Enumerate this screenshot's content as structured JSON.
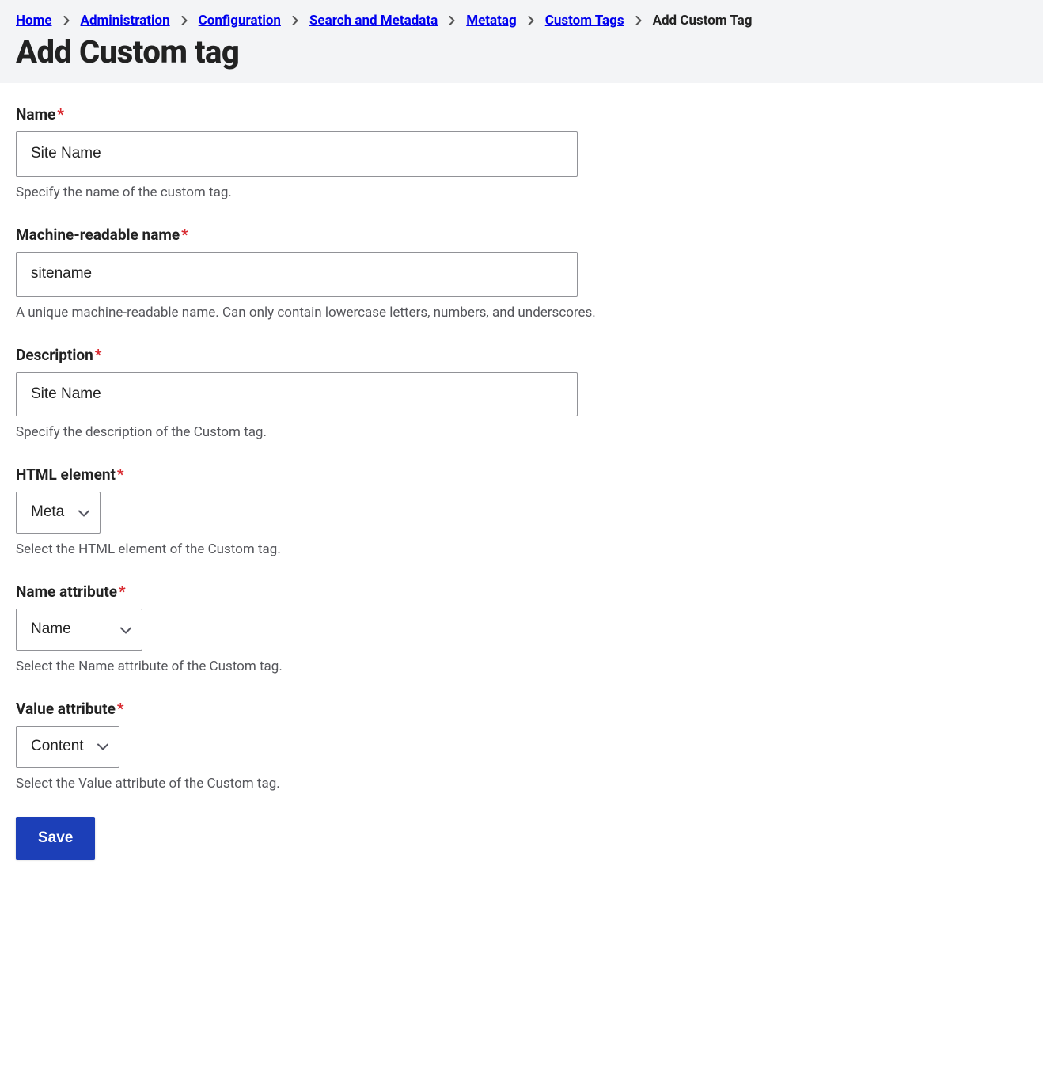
{
  "breadcrumbs": [
    {
      "label": "Home"
    },
    {
      "label": "Administration"
    },
    {
      "label": "Configuration"
    },
    {
      "label": "Search and Metadata"
    },
    {
      "label": "Metatag"
    },
    {
      "label": "Custom Tags"
    },
    {
      "label": "Add Custom Tag"
    }
  ],
  "page_title": "Add Custom tag",
  "form": {
    "name": {
      "label": "Name",
      "value": "Site Name",
      "description": "Specify the name of the custom tag."
    },
    "machine_name": {
      "label": "Machine-readable name",
      "value": "sitename",
      "description": "A unique machine-readable name. Can only contain lowercase letters, numbers, and underscores."
    },
    "description_field": {
      "label": "Description",
      "value": "Site Name",
      "description": "Specify the description of the Custom tag."
    },
    "html_element": {
      "label": "HTML element",
      "value": "Meta",
      "description": "Select the HTML element of the Custom tag."
    },
    "name_attribute": {
      "label": "Name attribute",
      "value": "Name",
      "description": "Select the Name attribute of the Custom tag."
    },
    "value_attribute": {
      "label": "Value attribute",
      "value": "Content",
      "description": "Select the Value attribute of the Custom tag."
    }
  },
  "actions": {
    "save": "Save"
  }
}
